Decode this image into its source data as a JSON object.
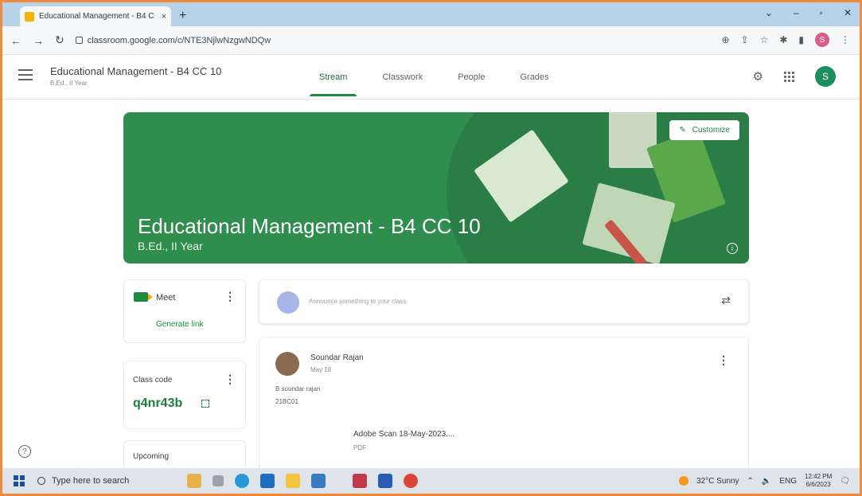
{
  "browser": {
    "tab_title": "Educational Management - B4 C",
    "tab_close": "×",
    "new_tab": "+",
    "url": "classroom.google.com/c/NTE3NjlwNzgwNDQw",
    "profile_initial": "S"
  },
  "classroom": {
    "class_title": "Educational Management - B4 CC 10",
    "class_subtitle": "B.Ed., II Year",
    "tabs": [
      {
        "label": "Stream",
        "active": true
      },
      {
        "label": "Classwork",
        "active": false
      },
      {
        "label": "People",
        "active": false
      },
      {
        "label": "Grades",
        "active": false
      }
    ],
    "avatar_initial": "S"
  },
  "banner": {
    "title": "Educational Management - B4 CC 10",
    "subtitle": "B.Ed., II Year",
    "customize_label": "Customize",
    "color": "#2f8d4d"
  },
  "sidebar": {
    "meet_label": "Meet",
    "generate_link": "Generate link",
    "class_code_label": "Class code",
    "class_code": "q4nr43b",
    "upcoming_label": "Upcoming"
  },
  "stream": {
    "announce_placeholder": "Announce something to your class",
    "post": {
      "author": "Soundar Rajan",
      "date": "May 18",
      "line1": "B soundar rajan",
      "line2": "21BC01",
      "attachment_title": "Adobe Scan 18-May-2023....",
      "attachment_type": "PDF"
    }
  },
  "taskbar": {
    "search_placeholder": "Type here to search",
    "weather": "32°C  Sunny",
    "lang": "ENG",
    "time": "12:42 PM",
    "date": "6/6/2023"
  },
  "colors": {
    "accent_green": "#1e8e3e",
    "frame_orange": "#f08a3c"
  }
}
